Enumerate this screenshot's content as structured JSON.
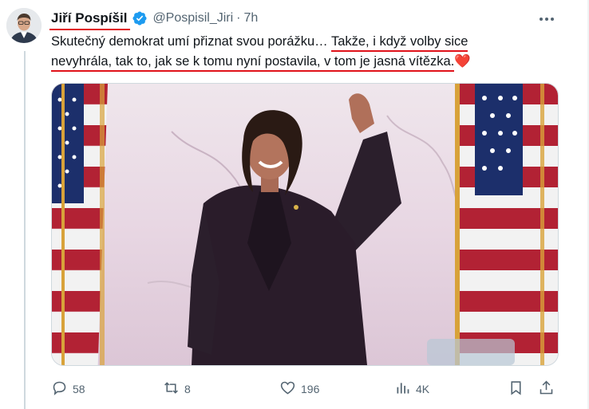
{
  "tweet": {
    "author_name": "Jiří Pospíšil",
    "handle": "@Pospisil_Jiri",
    "separator": "·",
    "time": "7h",
    "text_part1": "Skutečný demokrat umí přiznat svou porážku… ",
    "text_underlined_1": "Takže, i když volby sice",
    "text_underlined_2": "nevyhrála, tak to, jak se k tomu nyní postavila, v tom je jasná vítězka.",
    "emoji": "❤️"
  },
  "actions": {
    "replies": "58",
    "reposts": "8",
    "likes": "196",
    "views": "4K"
  },
  "icons": {
    "verified": "verified-badge-icon",
    "more": "more-horizontal-icon",
    "reply": "reply-icon",
    "repost": "repost-icon",
    "like": "heart-icon",
    "views": "views-icon",
    "bookmark": "bookmark-icon",
    "share": "share-icon"
  },
  "colors": {
    "verified_blue": "#1d9bf0",
    "text": "#0f1419",
    "muted": "#536471",
    "annotation_red": "#e0121a"
  }
}
